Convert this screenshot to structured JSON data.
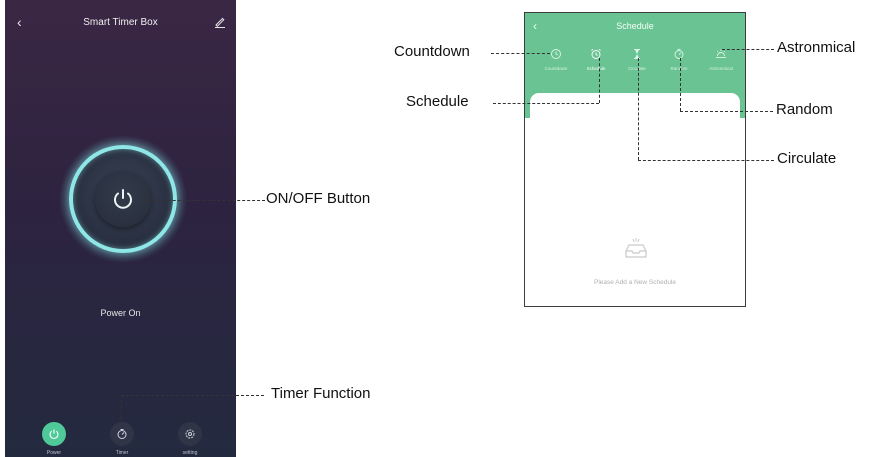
{
  "left_phone": {
    "title": "Smart Timer Box",
    "status": "Power On",
    "tabs": [
      {
        "label": "Power",
        "icon": "power-icon",
        "active": true
      },
      {
        "label": "Timer",
        "icon": "timer-icon",
        "active": false
      },
      {
        "label": "setting",
        "icon": "gear-icon",
        "active": false
      }
    ]
  },
  "right_phone": {
    "title": "Schedule",
    "tabs": [
      {
        "label": "Countdown",
        "icon": "clock-icon"
      },
      {
        "label": "Schedule",
        "icon": "alarm-clock-icon"
      },
      {
        "label": "Circulate",
        "icon": "hourglass-icon"
      },
      {
        "label": "Random",
        "icon": "timer-icon"
      },
      {
        "label": "Astronmical",
        "icon": "sunrise-icon"
      }
    ],
    "empty_text": "Please Add a New Schedule"
  },
  "callouts": {
    "on_off": "ON/OFF Button",
    "timer_function": "Timer Function",
    "countdown": "Countdown",
    "schedule": "Schedule",
    "astronomical": "Astronmical",
    "random": "Random",
    "circulate": "Circulate"
  },
  "colors": {
    "accent_green": "#4fc99a",
    "header_green": "#69c392",
    "ring_cyan": "#8fe6e6",
    "bg_top": "#3a2744",
    "bg_bottom": "#232a3f"
  }
}
